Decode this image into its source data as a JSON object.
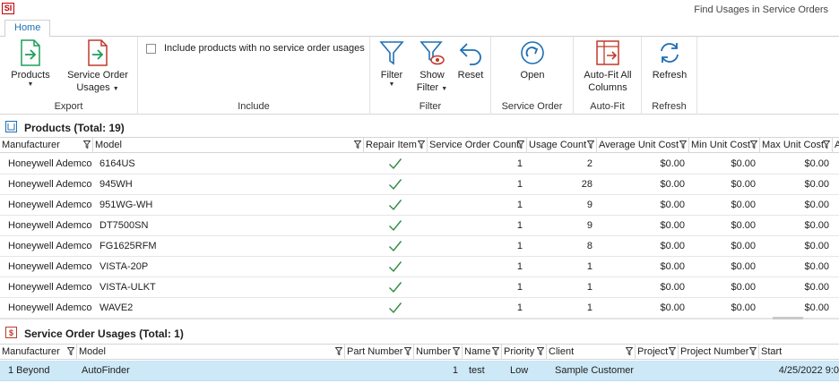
{
  "app": {
    "logo": "SI",
    "window_title": "Find Usages in Service Orders"
  },
  "tabs": [
    {
      "label": "Home"
    }
  ],
  "ribbon": {
    "export": {
      "label": "Export",
      "products_label": "Products",
      "service_order_usages_line1": "Service Order",
      "service_order_usages_line2": "Usages"
    },
    "include": {
      "label": "Include",
      "checkbox_label": "Include products with no service order usages",
      "checked": false
    },
    "filter": {
      "label": "Filter",
      "filter_label": "Filter",
      "show_filter_line1": "Show",
      "show_filter_line2": "Filter",
      "reset_label": "Reset"
    },
    "service_order": {
      "label": "Service Order",
      "open_label": "Open"
    },
    "autofit": {
      "label": "Auto-Fit",
      "button_line1": "Auto-Fit All",
      "button_line2": "Columns"
    },
    "refresh": {
      "label": "Refresh",
      "button_label": "Refresh"
    }
  },
  "products": {
    "title": "Products (Total: 19)",
    "columns": [
      "Manufacturer",
      "Model",
      "Repair Item",
      "Service Order Count",
      "Usage Count",
      "Average Unit Cost",
      "Min Unit Cost",
      "Max Unit Cost",
      "A"
    ],
    "rows": [
      {
        "manufacturer": "Honeywell Ademco",
        "model": "6164US",
        "repair_item": true,
        "service_order_count": "1",
        "usage_count": "2",
        "avg_cost": "$0.00",
        "min_cost": "$0.00",
        "max_cost": "$0.00"
      },
      {
        "manufacturer": "Honeywell Ademco",
        "model": "945WH",
        "repair_item": true,
        "service_order_count": "1",
        "usage_count": "28",
        "avg_cost": "$0.00",
        "min_cost": "$0.00",
        "max_cost": "$0.00"
      },
      {
        "manufacturer": "Honeywell Ademco",
        "model": "951WG-WH",
        "repair_item": true,
        "service_order_count": "1",
        "usage_count": "9",
        "avg_cost": "$0.00",
        "min_cost": "$0.00",
        "max_cost": "$0.00"
      },
      {
        "manufacturer": "Honeywell Ademco",
        "model": "DT7500SN",
        "repair_item": true,
        "service_order_count": "1",
        "usage_count": "9",
        "avg_cost": "$0.00",
        "min_cost": "$0.00",
        "max_cost": "$0.00"
      },
      {
        "manufacturer": "Honeywell Ademco",
        "model": "FG1625RFM",
        "repair_item": true,
        "service_order_count": "1",
        "usage_count": "8",
        "avg_cost": "$0.00",
        "min_cost": "$0.00",
        "max_cost": "$0.00"
      },
      {
        "manufacturer": "Honeywell Ademco",
        "model": "VISTA-20P",
        "repair_item": true,
        "service_order_count": "1",
        "usage_count": "1",
        "avg_cost": "$0.00",
        "min_cost": "$0.00",
        "max_cost": "$0.00"
      },
      {
        "manufacturer": "Honeywell Ademco",
        "model": "VISTA-ULKT",
        "repair_item": true,
        "service_order_count": "1",
        "usage_count": "1",
        "avg_cost": "$0.00",
        "min_cost": "$0.00",
        "max_cost": "$0.00"
      },
      {
        "manufacturer": "Honeywell Ademco",
        "model": "WAVE2",
        "repair_item": true,
        "service_order_count": "1",
        "usage_count": "1",
        "avg_cost": "$0.00",
        "min_cost": "$0.00",
        "max_cost": "$0.00"
      }
    ]
  },
  "usages": {
    "title": "Service Order Usages (Total: 1)",
    "columns": [
      "Manufacturer",
      "Model",
      "Part Number",
      "Number",
      "Name",
      "Priority",
      "Client",
      "Project",
      "Project Number",
      "Start"
    ],
    "rows": [
      {
        "manufacturer": "1 Beyond",
        "model": "AutoFinder",
        "part_number": "",
        "number": "1",
        "name": "test",
        "priority": "Low",
        "client": "Sample Customer",
        "project": "",
        "project_number": "",
        "start": "4/25/2022 9:0"
      }
    ]
  },
  "colors": {
    "accent": "#1f6fb5",
    "selected_row": "#cde8f7",
    "check": "#2e8b3e",
    "icon_green": "#1a9f5a",
    "icon_red": "#c0392b",
    "icon_blue": "#1f6fb5"
  }
}
